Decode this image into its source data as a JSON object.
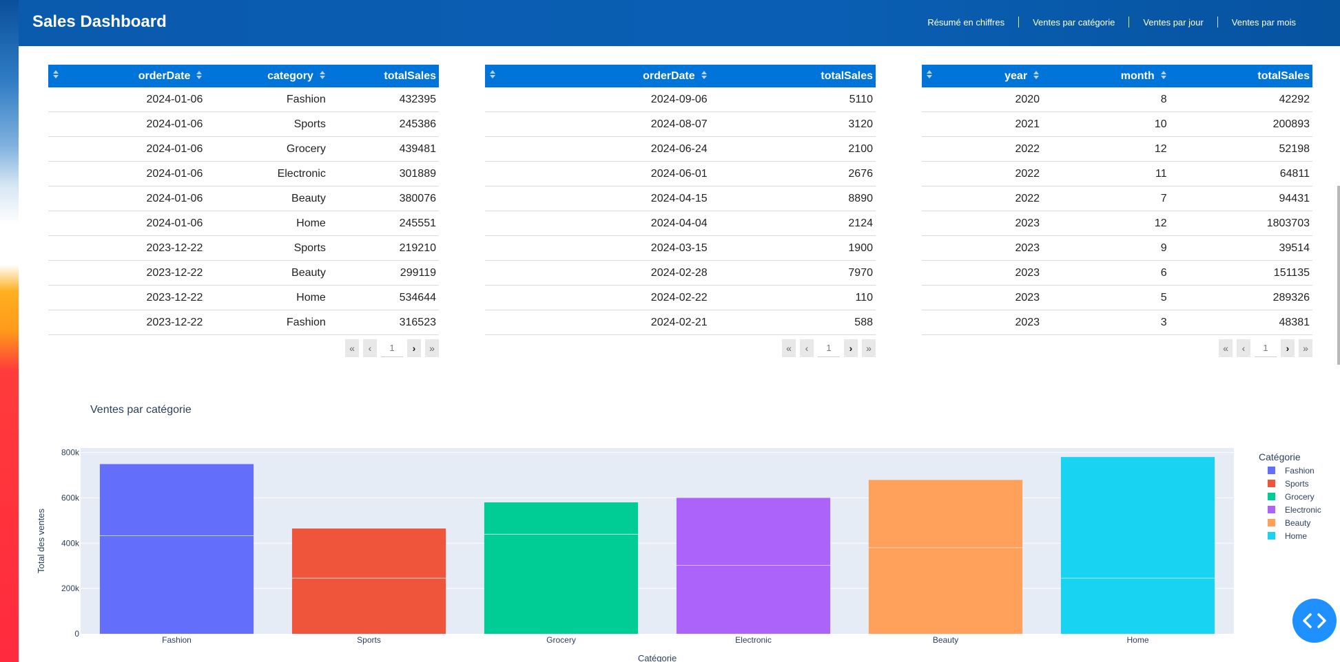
{
  "nav": {
    "brand": "Sales Dashboard",
    "links": [
      "Résumé en chiffres",
      "Ventes par catégorie",
      "Ventes par jour",
      "Ventes par mois"
    ]
  },
  "tables": [
    {
      "headers": [
        "orderDate",
        "category",
        "totalSales"
      ],
      "rows": [
        [
          "2024-01-06",
          "Fashion",
          "432395"
        ],
        [
          "2024-01-06",
          "Sports",
          "245386"
        ],
        [
          "2024-01-06",
          "Grocery",
          "439481"
        ],
        [
          "2024-01-06",
          "Electronic",
          "301889"
        ],
        [
          "2024-01-06",
          "Beauty",
          "380076"
        ],
        [
          "2024-01-06",
          "Home",
          "245551"
        ],
        [
          "2023-12-22",
          "Sports",
          "219210"
        ],
        [
          "2023-12-22",
          "Beauty",
          "299119"
        ],
        [
          "2023-12-22",
          "Home",
          "534644"
        ],
        [
          "2023-12-22",
          "Fashion",
          "316523"
        ]
      ],
      "page": "1"
    },
    {
      "headers": [
        "orderDate",
        "totalSales"
      ],
      "rows": [
        [
          "2024-09-06",
          "5110"
        ],
        [
          "2024-08-07",
          "3120"
        ],
        [
          "2024-06-24",
          "2100"
        ],
        [
          "2024-06-01",
          "2676"
        ],
        [
          "2024-04-15",
          "8890"
        ],
        [
          "2024-04-04",
          "2124"
        ],
        [
          "2024-03-15",
          "1900"
        ],
        [
          "2024-02-28",
          "7970"
        ],
        [
          "2024-02-22",
          "110"
        ],
        [
          "2024-02-21",
          "588"
        ]
      ],
      "page": "1"
    },
    {
      "headers": [
        "year",
        "month",
        "totalSales"
      ],
      "rows": [
        [
          "2020",
          "8",
          "42292"
        ],
        [
          "2021",
          "10",
          "200893"
        ],
        [
          "2022",
          "12",
          "52198"
        ],
        [
          "2022",
          "11",
          "64811"
        ],
        [
          "2022",
          "7",
          "94431"
        ],
        [
          "2023",
          "12",
          "1803703"
        ],
        [
          "2023",
          "9",
          "39514"
        ],
        [
          "2023",
          "6",
          "151135"
        ],
        [
          "2023",
          "5",
          "289326"
        ],
        [
          "2023",
          "3",
          "48381"
        ]
      ],
      "page": "1"
    }
  ],
  "chart_data": {
    "type": "bar",
    "title": "Ventes par catégorie",
    "xlabel": "Catégorie",
    "ylabel": "Total des ventes",
    "ylim": [
      0,
      820000
    ],
    "ytick_labels": [
      "0",
      "200k",
      "400k",
      "600k",
      "800k"
    ],
    "ytick_values": [
      0,
      200000,
      400000,
      600000,
      800000
    ],
    "categories": [
      "Fashion",
      "Sports",
      "Grocery",
      "Electronic",
      "Beauty",
      "Home"
    ],
    "values": [
      748918,
      464596,
      580000,
      600000,
      679195,
      780195
    ],
    "segments_bottom": [
      432395,
      245386,
      439481,
      301889,
      380076,
      245551
    ],
    "colors": [
      "#636efa",
      "#ef553b",
      "#00cc96",
      "#ab63fa",
      "#ffa15a",
      "#19d3f3"
    ],
    "legend_title": "Catégorie",
    "legend_placement": "right",
    "grid": true
  }
}
